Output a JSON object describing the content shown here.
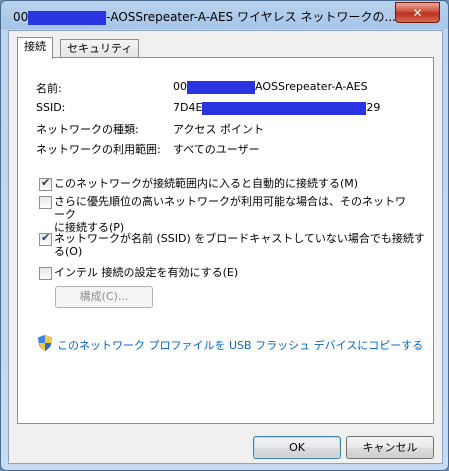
{
  "window": {
    "title_prefix": "00",
    "title_suffix": "-AOSSrepeater-A-AES ワイヤレス ネットワークの...",
    "close_glyph": "✕"
  },
  "tabs": [
    {
      "label": "接続",
      "active": true
    },
    {
      "label": "セキュリティ",
      "active": false
    }
  ],
  "fields": {
    "name_label": "名前:",
    "name_value_prefix": "00",
    "name_value_suffix": "AOSSrepeater-A-AES",
    "ssid_label": "SSID:",
    "ssid_value_prefix": "7D4E",
    "ssid_value_suffix": "29",
    "type_label": "ネットワークの種類:",
    "type_value": "アクセス ポイント",
    "scope_label": "ネットワークの利用範囲:",
    "scope_value": "すべてのユーザー"
  },
  "options": [
    {
      "label": "このネットワークが接続範囲内に入ると自動的に接続する(M)",
      "checked": true
    },
    {
      "label": "さらに優先順位の高いネットワークが利用可能な場合は、そのネットワーク\nに接続する(P)",
      "checked": false
    },
    {
      "label": "ネットワークが名前 (SSID) をブロードキャストしていない場合でも接続する(O)",
      "checked": true
    },
    {
      "label": "インテル 接続の設定を有効にする(E)",
      "checked": false
    }
  ],
  "configure_button": "構成(C)...",
  "copy_link": "このネットワーク プロファイルを USB フラッシュ デバイスにコピーする",
  "ok_button": "OK",
  "cancel_button": "キャンセル",
  "redaction_color": "#2a34e0",
  "link_color": "#0066cc"
}
